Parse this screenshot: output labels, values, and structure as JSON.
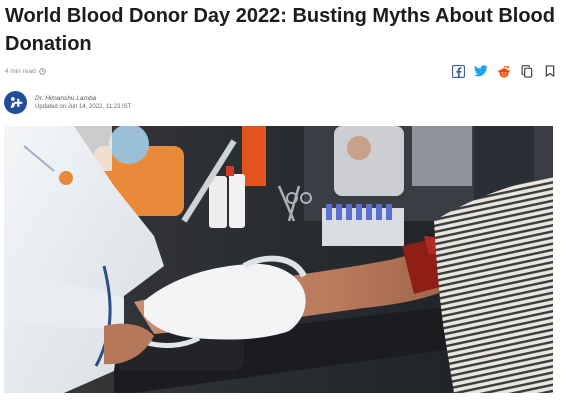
{
  "article": {
    "title": "World Blood Donor Day 2022: Busting Myths About Blood Donation",
    "read_time": "4 min read",
    "author": "Dr. Himanshu Lamba",
    "updated": "Updated on Jun 14, 2022, 11:23 IST"
  },
  "share": {
    "icons": [
      "facebook-icon",
      "twitter-icon",
      "reddit-icon",
      "copy-link-icon",
      "bookmark-icon"
    ]
  },
  "colors": {
    "facebook": "#3b5998",
    "twitter": "#1da1f2",
    "reddit": "#ff4500",
    "avatar": "#1f4f9a"
  },
  "hero_image": {
    "subject": "blood-donation-photo"
  }
}
